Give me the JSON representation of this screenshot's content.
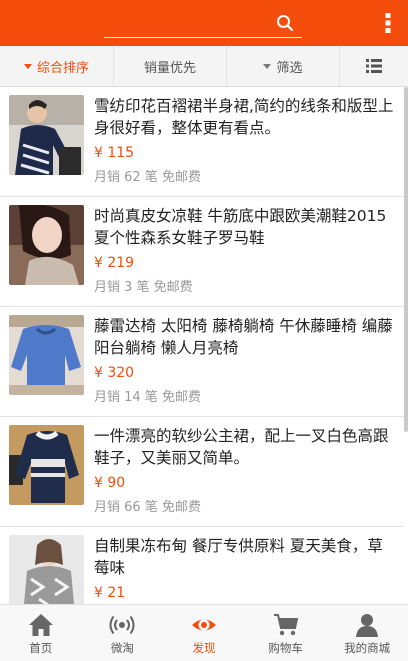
{
  "search": {
    "placeholder": ""
  },
  "filters": [
    {
      "label": "综合排序"
    },
    {
      "label": "销量优先"
    },
    {
      "label": "筛选"
    }
  ],
  "products": [
    {
      "title": "雪纺印花百褶裙半身裙,简约的线条和版型上身很好看，整体更有看点。",
      "price": "¥ 115",
      "sales": "月销 62 笔 免邮费"
    },
    {
      "title": "时尚真皮女凉鞋 牛筋底中跟欧美潮鞋2015夏个性森系女鞋子罗马鞋",
      "price": "¥ 219",
      "sales": "月销 3 笔 免邮费"
    },
    {
      "title": "藤雷达椅 太阳椅 藤椅躺椅 午休藤睡椅 编藤阳台躺椅 懒人月亮椅",
      "price": "¥ 320",
      "sales": "月销 14 笔 免邮费"
    },
    {
      "title": "一件漂亮的软纱公主裙，配上一叉白色高跟鞋子，又美丽又简单。",
      "price": "¥ 90",
      "sales": "月销 66 笔 免邮费"
    },
    {
      "title": "自制果冻布甸 餐厅专供原料 夏天美食，草莓味",
      "price": "¥ 21",
      "sales": ""
    }
  ],
  "tabbar": [
    {
      "label": "首页",
      "icon": "home-icon"
    },
    {
      "label": "微淘",
      "icon": "broadcast-icon"
    },
    {
      "label": "发现",
      "icon": "eye-icon"
    },
    {
      "label": "购物车",
      "icon": "cart-icon"
    },
    {
      "label": "我的商城",
      "icon": "user-icon"
    }
  ],
  "colors": {
    "accent": "#f44c0a",
    "tab_icon": "#666666"
  }
}
